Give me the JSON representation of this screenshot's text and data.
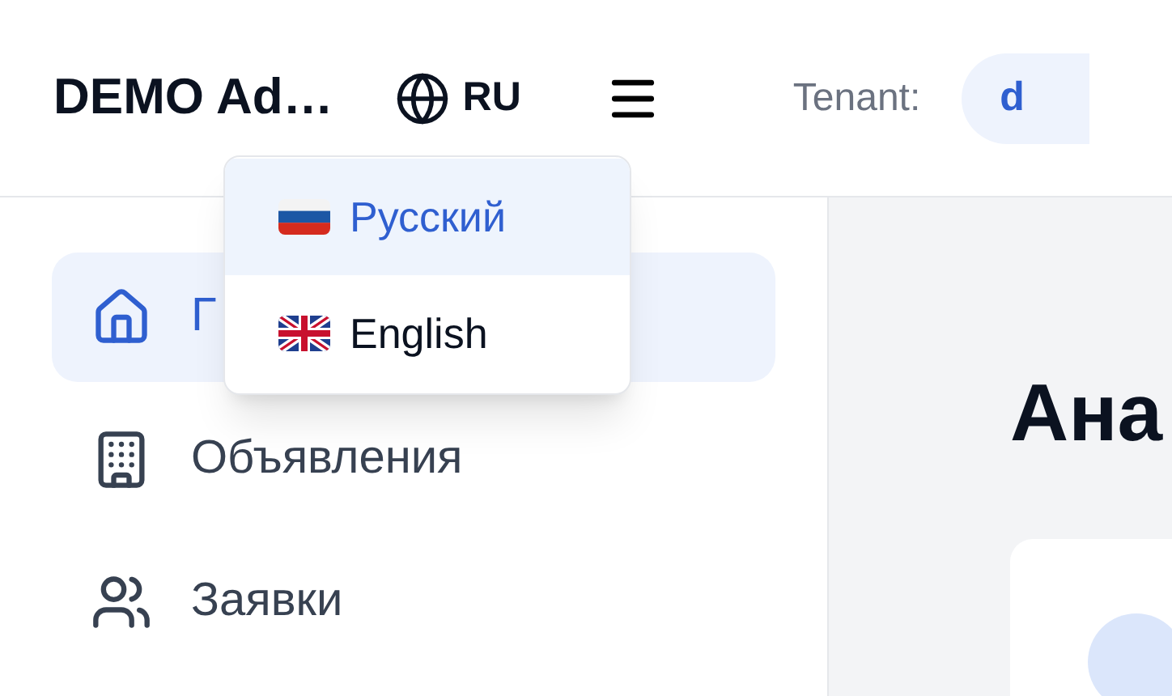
{
  "header": {
    "title": "DEMO Ad…",
    "language_button": "RU",
    "tenant_label": "Tenant:",
    "tenant_value": "d"
  },
  "sidebar": {
    "items": [
      {
        "label": "Г",
        "kind": "home",
        "selected": true
      },
      {
        "label": "Объявления",
        "kind": "building",
        "selected": false
      },
      {
        "label": "Заявки",
        "kind": "users",
        "selected": false
      }
    ]
  },
  "language_menu": {
    "items": [
      {
        "label": "Русский",
        "kind": "ru",
        "selected": true
      },
      {
        "label": "English",
        "kind": "gb",
        "selected": false
      }
    ]
  },
  "main": {
    "heading": "Ана"
  }
}
